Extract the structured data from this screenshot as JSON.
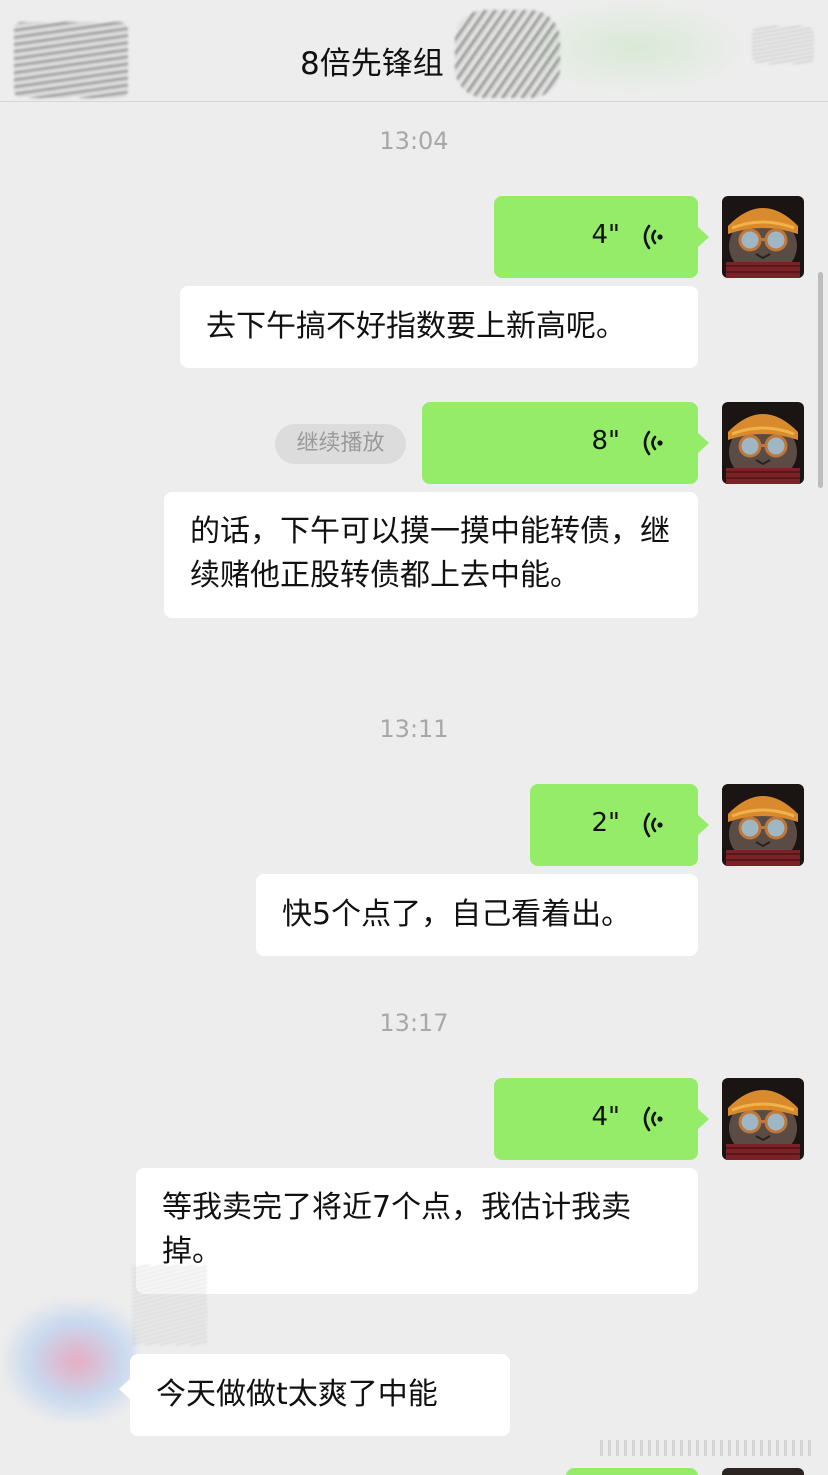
{
  "header": {
    "title": "8倍先锋组"
  },
  "colors": {
    "outgoing_bubble": "#95ec69",
    "incoming_bubble": "#ffffff",
    "background": "#ededed",
    "timestamp": "#a8a8a8"
  },
  "messages": {
    "ts1": "13:04",
    "voice1": "4\"",
    "text1": "去下午搞不好指数要上新高呢。",
    "continue_label": "继续播放",
    "voice2": "8\"",
    "text2": "的话，下午可以摸一摸中能转债，继续赌他正股转债都上去中能。",
    "ts2": "13:11",
    "voice3": "2\"",
    "text3": "快5个点了，自己看着出。",
    "ts3": "13:17",
    "voice4": "4\"",
    "text4": "等我卖完了将近7个点，我估计我卖掉。",
    "text5": "今天做做t太爽了中能"
  },
  "icons": {
    "voice": "voice-wave-icon",
    "avatar": "cat-avatar-icon"
  }
}
